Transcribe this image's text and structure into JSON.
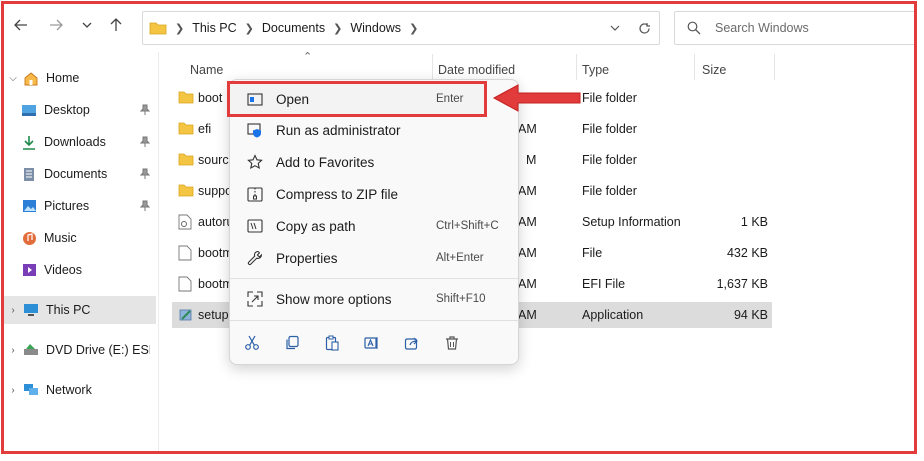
{
  "address": {
    "crumbs": [
      "This PC",
      "Documents",
      "Windows"
    ]
  },
  "search": {
    "placeholder": "Search Windows"
  },
  "sidebar": {
    "items": [
      {
        "label": "Home"
      },
      {
        "label": "Desktop"
      },
      {
        "label": "Downloads"
      },
      {
        "label": "Documents"
      },
      {
        "label": "Pictures"
      },
      {
        "label": "Music"
      },
      {
        "label": "Videos"
      },
      {
        "label": "This PC"
      },
      {
        "label": "DVD Drive (E:) ESD-ISO"
      },
      {
        "label": "Network"
      }
    ]
  },
  "columns": {
    "name": "Name",
    "date": "Date modified",
    "type": "Type",
    "size": "Size"
  },
  "files": [
    {
      "name": "boot",
      "date": "",
      "type": "File folder",
      "size": ""
    },
    {
      "name": "efi",
      "date": "AM",
      "type": "File folder",
      "size": ""
    },
    {
      "name": "sources",
      "date": "M",
      "type": "File folder",
      "size": ""
    },
    {
      "name": "support",
      "date": "AM",
      "type": "File folder",
      "size": ""
    },
    {
      "name": "autorun",
      "date": "AM",
      "type": "Setup Information",
      "size": "1 KB"
    },
    {
      "name": "bootmgr",
      "date": "AM",
      "type": "File",
      "size": "432 KB"
    },
    {
      "name": "bootmgr",
      "date": "AM",
      "type": "EFI File",
      "size": "1,637 KB"
    },
    {
      "name": "setup",
      "date": "AM",
      "type": "Application",
      "size": "94 KB"
    }
  ],
  "menu": {
    "items": [
      {
        "label": "Open",
        "shortcut": "Enter"
      },
      {
        "label": "Run as administrator",
        "shortcut": ""
      },
      {
        "label": "Add to Favorites",
        "shortcut": ""
      },
      {
        "label": "Compress to ZIP file",
        "shortcut": ""
      },
      {
        "label": "Copy as path",
        "shortcut": "Ctrl+Shift+C"
      },
      {
        "label": "Properties",
        "shortcut": "Alt+Enter"
      },
      {
        "label": "Show more options",
        "shortcut": "Shift+F10"
      }
    ]
  },
  "colors": {
    "highlight": "#e23b3b",
    "folder": "#f4c542",
    "accent": "#1a73e8"
  }
}
